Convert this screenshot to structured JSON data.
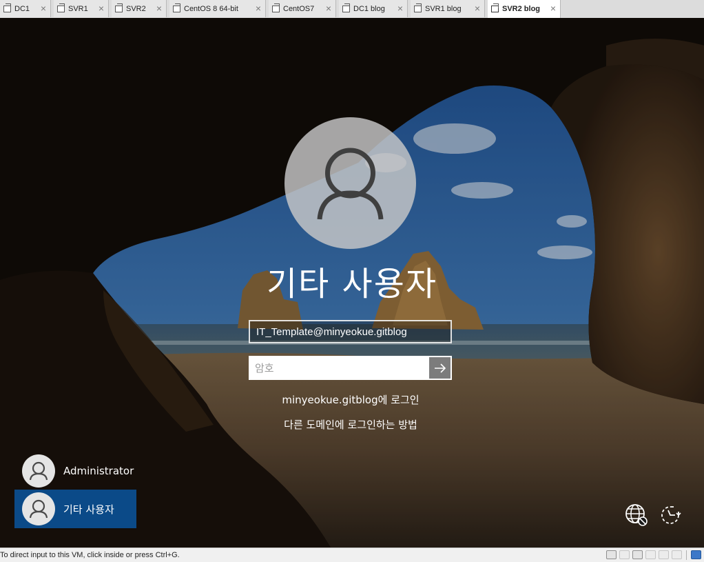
{
  "tabs": [
    {
      "label": "DC1",
      "active": false
    },
    {
      "label": "SVR1",
      "active": false
    },
    {
      "label": "SVR2",
      "active": false
    },
    {
      "label": "CentOS 8 64-bit",
      "active": false
    },
    {
      "label": "CentOS7",
      "active": false
    },
    {
      "label": "DC1 blog",
      "active": false
    },
    {
      "label": "SVR1 blog",
      "active": false
    },
    {
      "label": "SVR2 blog",
      "active": true
    }
  ],
  "tab_close_glyph": "×",
  "login": {
    "user_title": "기타 사용자",
    "username_value": "IT_Template@minyeokue.gitblog",
    "password_placeholder": "암호",
    "submit_icon": "arrow-right-icon",
    "signin_domain_text": "minyeokue.gitblog에 로그인",
    "other_domain_link": "다른 도메인에 로그인하는 방법"
  },
  "user_list": [
    {
      "name": "Administrator",
      "selected": false
    },
    {
      "name": "기타 사용자",
      "selected": true
    }
  ],
  "corner_icons": [
    "network-icon",
    "ease-of-access-icon"
  ],
  "statusbar": {
    "text": "To direct input to this VM, click inside or press Ctrl+G."
  },
  "colors": {
    "selected_user_tile": "#0b4a88",
    "tab_bar": "#dcdcdc",
    "status_bar": "#f0f0f0"
  }
}
